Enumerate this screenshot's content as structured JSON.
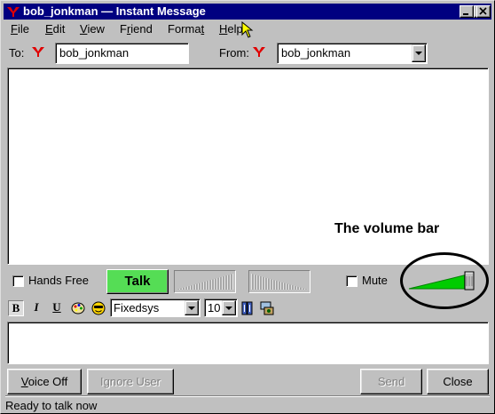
{
  "window": {
    "title": "bob_jonkman — Instant Message",
    "app_icon": "yahoo-y-icon",
    "controls": [
      "minimize-icon",
      "maximize-icon",
      "close-icon"
    ]
  },
  "menu": {
    "items": [
      {
        "label": "File",
        "mnemonic": "F",
        "rest": "ile"
      },
      {
        "label": "Edit",
        "mnemonic": "E",
        "rest": "dit"
      },
      {
        "label": "View",
        "mnemonic": "V",
        "rest": "iew"
      },
      {
        "label": "Friend",
        "pre": "F",
        "mnemonic": "r",
        "rest": "iend"
      },
      {
        "label": "Format",
        "pre": "Forma",
        "mnemonic": "t",
        "rest": ""
      },
      {
        "label": "Help",
        "mnemonic": "H",
        "rest": "elp"
      }
    ]
  },
  "header": {
    "to_label": "To:",
    "to_value": "bob_jonkman",
    "from_label": "From:",
    "from_value": "bob_jonkman"
  },
  "annotation": "The volume bar",
  "voice": {
    "hands_free_label": "Hands Free",
    "hands_free_checked": false,
    "talk_label": "Talk",
    "mute_label": "Mute",
    "mute_checked": false,
    "volume_level": 0.95,
    "colors": {
      "talk": "#55dd55",
      "volume": "#00cc00"
    }
  },
  "toolbar": {
    "bold": "B",
    "italic": "I",
    "underline": "U",
    "palette_icon": "color-palette-icon",
    "smiley_icon": "smiley-icon",
    "font": "Fixedsys",
    "size": "10",
    "book_icon": "address-book-icon",
    "voice_icon": "voice-chat-icon"
  },
  "buttons": {
    "voice_off": "Voice Off",
    "voice_off_mnemonic": "V",
    "ignore_user": "Ignore User",
    "send": "Send",
    "close": "Close"
  },
  "status": "Ready to talk now"
}
